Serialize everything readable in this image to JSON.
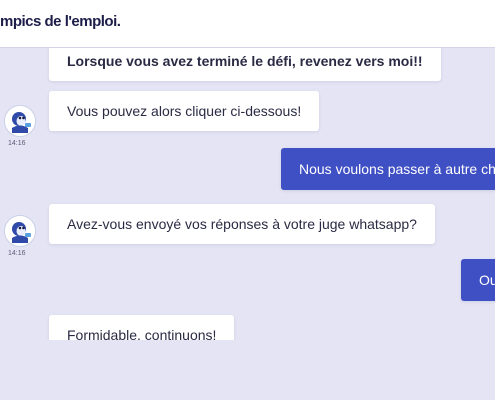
{
  "header": {
    "title": "mpics de l'emploi."
  },
  "messages": [
    {
      "from": "bot",
      "text": "Lorsque vous avez terminé le défi, revenez vers moi!!"
    },
    {
      "from": "bot",
      "text": "Vous pouvez alors cliquer ci-dessous!",
      "time": "14:16"
    },
    {
      "from": "user",
      "text": "Nous voulons passer à autre chos"
    },
    {
      "from": "bot",
      "text": "Avez-vous envoyé vos réponses à votre juge whatsapp?",
      "time": "14:16"
    },
    {
      "from": "user",
      "text": "Ou"
    },
    {
      "from": "bot",
      "text": "Formidable, continuons!"
    }
  ],
  "colors": {
    "accent": "#3f4fc4",
    "background": "#e4e4f4",
    "bubble": "#ffffff"
  },
  "icons": {
    "avatar": "bot-avatar-icon"
  }
}
